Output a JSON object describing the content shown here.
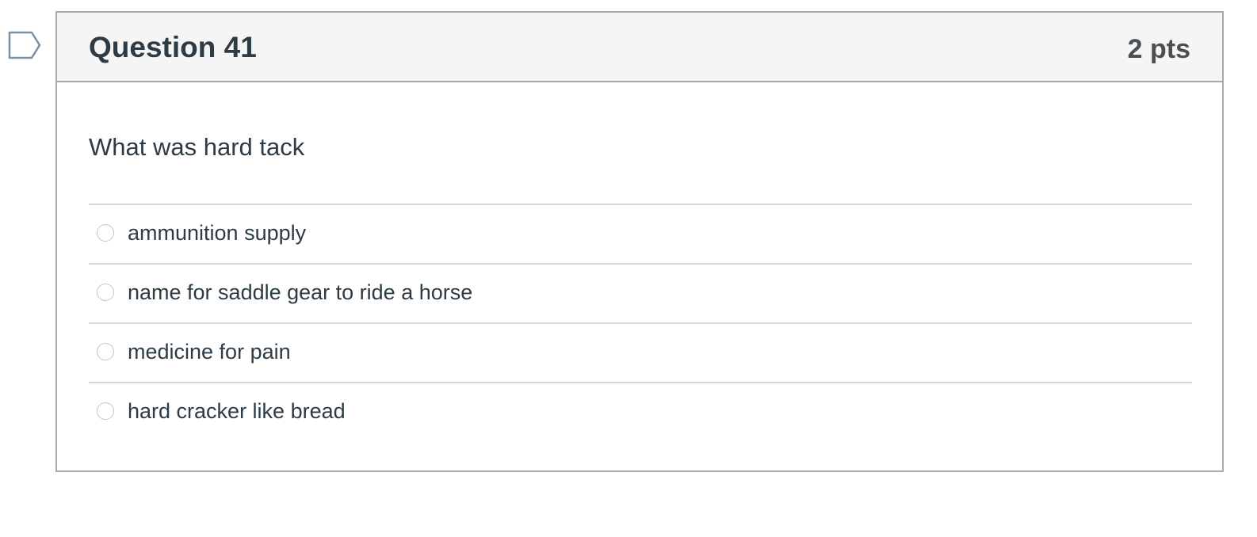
{
  "question": {
    "title": "Question 41",
    "points": "2 pts",
    "text": "What was hard tack",
    "flag_icon": "bookmark-flag-icon",
    "answers": [
      {
        "label": "ammunition supply",
        "selected": false
      },
      {
        "label": "name for saddle gear to ride a horse",
        "selected": false
      },
      {
        "label": "medicine for pain",
        "selected": false
      },
      {
        "label": "hard cracker like bread",
        "selected": false
      }
    ]
  },
  "colors": {
    "text": "#2d3b45",
    "header_bg": "#f5f5f5",
    "border": "#a9a9a9",
    "divider": "#d5d9dc",
    "flag_stroke": "#7b8fa3"
  }
}
